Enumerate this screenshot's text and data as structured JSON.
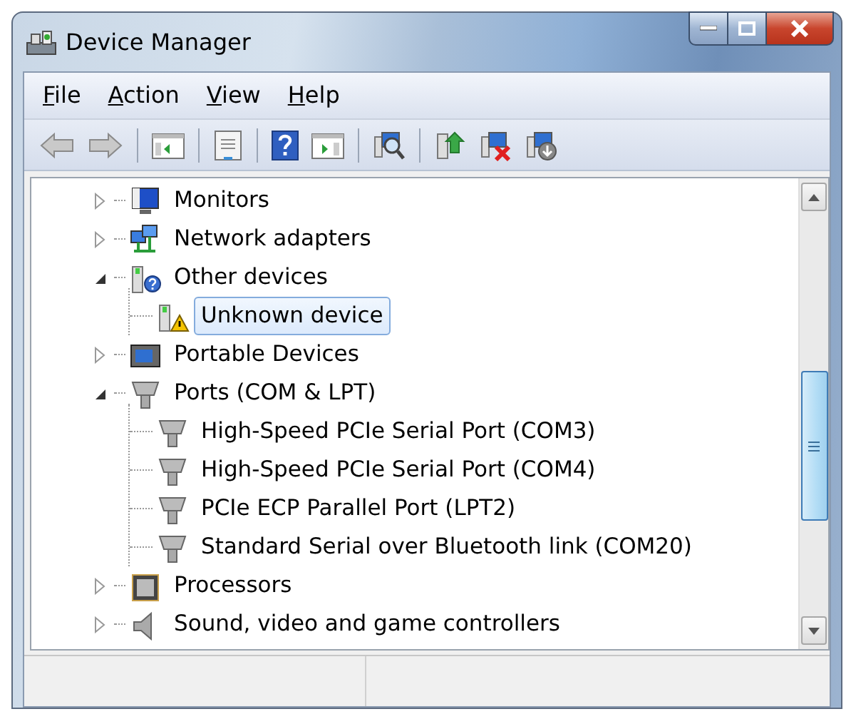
{
  "window": {
    "title": "Device Manager"
  },
  "menu": [
    {
      "label": "File"
    },
    {
      "label": "Action"
    },
    {
      "label": "View"
    },
    {
      "label": "Help"
    }
  ],
  "tree": [
    {
      "label": "Monitors",
      "expanded": false,
      "selected": false
    },
    {
      "label": "Network adapters",
      "expanded": false,
      "selected": false
    },
    {
      "label": "Other devices",
      "expanded": true,
      "selected": false,
      "children": [
        {
          "label": "Unknown device",
          "selected": true,
          "warning": true
        }
      ]
    },
    {
      "label": "Portable Devices",
      "expanded": false,
      "selected": false
    },
    {
      "label": "Ports (COM & LPT)",
      "expanded": true,
      "selected": false,
      "children": [
        {
          "label": "High-Speed PCIe Serial Port (COM3)",
          "selected": false,
          "warning": false
        },
        {
          "label": "High-Speed PCIe Serial Port (COM4)",
          "selected": false,
          "warning": false
        },
        {
          "label": "PCIe ECP Parallel Port (LPT2)",
          "selected": false,
          "warning": false
        },
        {
          "label": "Standard Serial over Bluetooth link (COM20)",
          "selected": false,
          "warning": false
        }
      ]
    },
    {
      "label": "Processors",
      "expanded": false,
      "selected": false
    },
    {
      "label": "Sound, video and game controllers",
      "expanded": false,
      "selected": false
    }
  ]
}
